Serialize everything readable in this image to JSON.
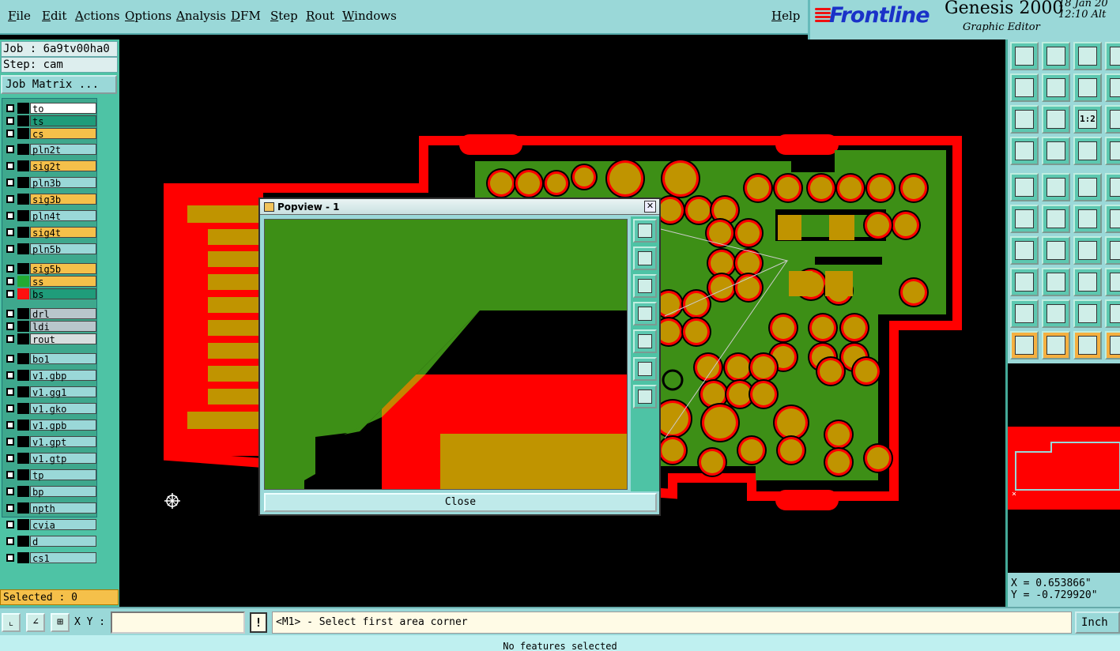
{
  "menu": [
    "File",
    "Edit",
    "Actions",
    "Options",
    "Analysis",
    "DFM",
    "Step",
    "Rout",
    "Windows"
  ],
  "help": "Help",
  "brand": {
    "logo": "Frontline",
    "product": "Genesis 2000",
    "subtitle": "Graphic Editor",
    "date": "18 Jan 20",
    "time": "12:10 Alt"
  },
  "job": {
    "job_line": "Job : 6a9tv00ha0",
    "step_line": "Step: cam",
    "job_matrix": "Job Matrix ..."
  },
  "layers": [
    {
      "name": "to",
      "color": "#ffffff",
      "swatch": "#000000"
    },
    {
      "name": "ts",
      "color": "#1f9c7a",
      "swatch": "#000000"
    },
    {
      "name": "cs",
      "color": "#f5c04a",
      "swatch": "#000000"
    },
    {
      "name": "pln2t",
      "color": "#9ad8d8",
      "swatch": "#000000"
    },
    {
      "name": "sig2t",
      "color": "#f5c04a",
      "swatch": "#000000"
    },
    {
      "name": "pln3b",
      "color": "#9ad8d8",
      "swatch": "#000000"
    },
    {
      "name": "sig3b",
      "color": "#f5c04a",
      "swatch": "#000000"
    },
    {
      "name": "pln4t",
      "color": "#9ad8d8",
      "swatch": "#000000"
    },
    {
      "name": "sig4t",
      "color": "#f5c04a",
      "swatch": "#000000"
    },
    {
      "name": "pln5b",
      "color": "#9ad8d8",
      "swatch": "#000000"
    },
    {
      "name": "sig5b",
      "color": "#f5c04a",
      "swatch": "#000000"
    },
    {
      "name": "ss",
      "color": "#f5c04a",
      "swatch": "#22aa33"
    },
    {
      "name": "bs",
      "color": "#1f9c7a",
      "swatch": "#ff1010"
    },
    {
      "name": "drl",
      "color": "#b8c6cc",
      "swatch": "#000000"
    },
    {
      "name": "ldi",
      "color": "#b8c6cc",
      "swatch": "#000000"
    },
    {
      "name": "rout",
      "color": "#d8dede",
      "swatch": "#000000"
    },
    {
      "name": "bo1",
      "color": "#9ad8d8",
      "swatch": "#000000"
    },
    {
      "name": "v1.gbp",
      "color": "#9ad8d8",
      "swatch": "#000000"
    },
    {
      "name": "v1.gg1",
      "color": "#9ad8d8",
      "swatch": "#000000"
    },
    {
      "name": "v1.gko",
      "color": "#9ad8d8",
      "swatch": "#000000"
    },
    {
      "name": "v1.gpb",
      "color": "#9ad8d8",
      "swatch": "#000000"
    },
    {
      "name": "v1.gpt",
      "color": "#9ad8d8",
      "swatch": "#000000"
    },
    {
      "name": "v1.gtp",
      "color": "#9ad8d8",
      "swatch": "#000000"
    },
    {
      "name": "tp",
      "color": "#9ad8d8",
      "swatch": "#000000"
    },
    {
      "name": "bp",
      "color": "#9ad8d8",
      "swatch": "#000000"
    },
    {
      "name": "npth",
      "color": "#9ad8d8",
      "swatch": "#000000"
    },
    {
      "name": "cvia",
      "color": "#9ad8d8",
      "swatch": "#000000"
    },
    {
      "name": "d",
      "color": "#9ad8d8",
      "swatch": "#000000"
    },
    {
      "name": "cs1",
      "color": "#9ad8d8",
      "swatch": "#000000"
    }
  ],
  "selected": "Selected : 0",
  "popview": {
    "title": "Popview - 1",
    "close_label": "Close"
  },
  "toolbar_icons": [
    "move-up-icon",
    "move-down-icon",
    "home-icon",
    "panel-icon",
    "move-left-icon",
    "move-right-icon",
    "reverse-icon",
    "step-icon",
    "zoom-fit-icon",
    "zoom-center-icon",
    "scale-1to2-icon",
    "help-icon",
    "measure-icon",
    "probe-icon",
    "layers-icon",
    "netlist-icon",
    "pad-icon",
    "line-icon",
    "ruler-icon",
    "circle-icon",
    "connect-icon",
    "cross-icon",
    "point-icon",
    "arrow-icon",
    "slash-red-icon",
    "slash-blue-icon",
    "arc-icon",
    "bracket-icon",
    "box-icon",
    "dash-icon",
    "rect-icon",
    "dot-icon",
    "triangle-icon",
    "a-icon",
    "trapezoid-icon",
    "corner-icon",
    "pointer-icon",
    "pointer-select-icon",
    "pointer-round-icon",
    "step-line-icon"
  ],
  "toolbar_labels": {
    "scale": "1:2"
  },
  "coords": {
    "x": "X = 0.653866\"",
    "y": "Y = -0.729920\""
  },
  "bottom": {
    "xy_label": "X Y :",
    "xy_value": "",
    "prompt": "<M1> - Select first area corner",
    "unit": "Inch",
    "status": "No features selected"
  },
  "colors": {
    "copper": "#ff0000",
    "plane": "#3d8f16",
    "pad": "#c09400",
    "panel": "#9ad8d8",
    "list_bg": "#4ec3a5"
  }
}
